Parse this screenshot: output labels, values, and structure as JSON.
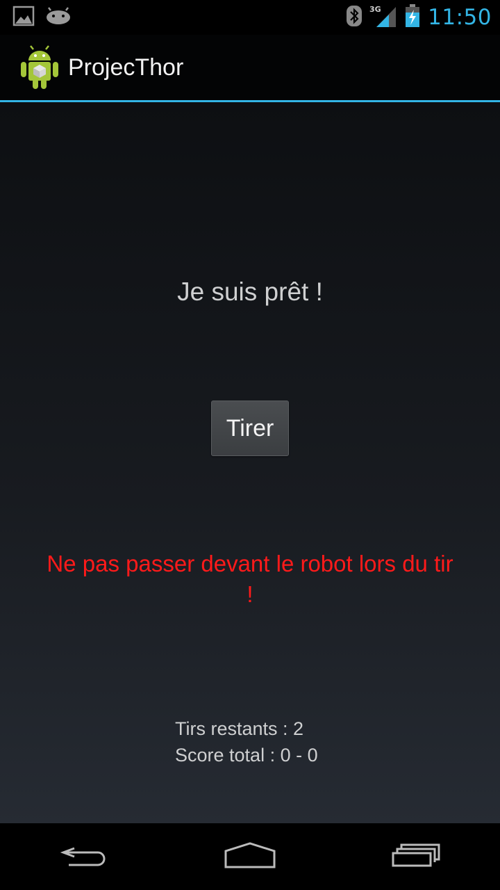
{
  "status_bar": {
    "time": "11:50",
    "network": "3G",
    "icons": [
      "picture-notification-icon",
      "android-notification-icon",
      "bluetooth-icon",
      "signal-icon",
      "battery-charging-icon"
    ]
  },
  "action_bar": {
    "title": "ProjecThor",
    "icon": "android-app-icon"
  },
  "main": {
    "status_message": "Je suis prêt !",
    "fire_button_label": "Tirer",
    "warning": "Ne pas passer devant le robot lors du tir !",
    "shots_remaining": "Tirs restants : 2",
    "total_score": "Score total : 0 - 0"
  },
  "nav_bar": {
    "buttons": [
      "back-icon",
      "home-icon",
      "recent-apps-icon"
    ]
  },
  "colors": {
    "accent": "#33b5e5",
    "warning": "#ff1a1a",
    "text": "#cfd0d1"
  }
}
